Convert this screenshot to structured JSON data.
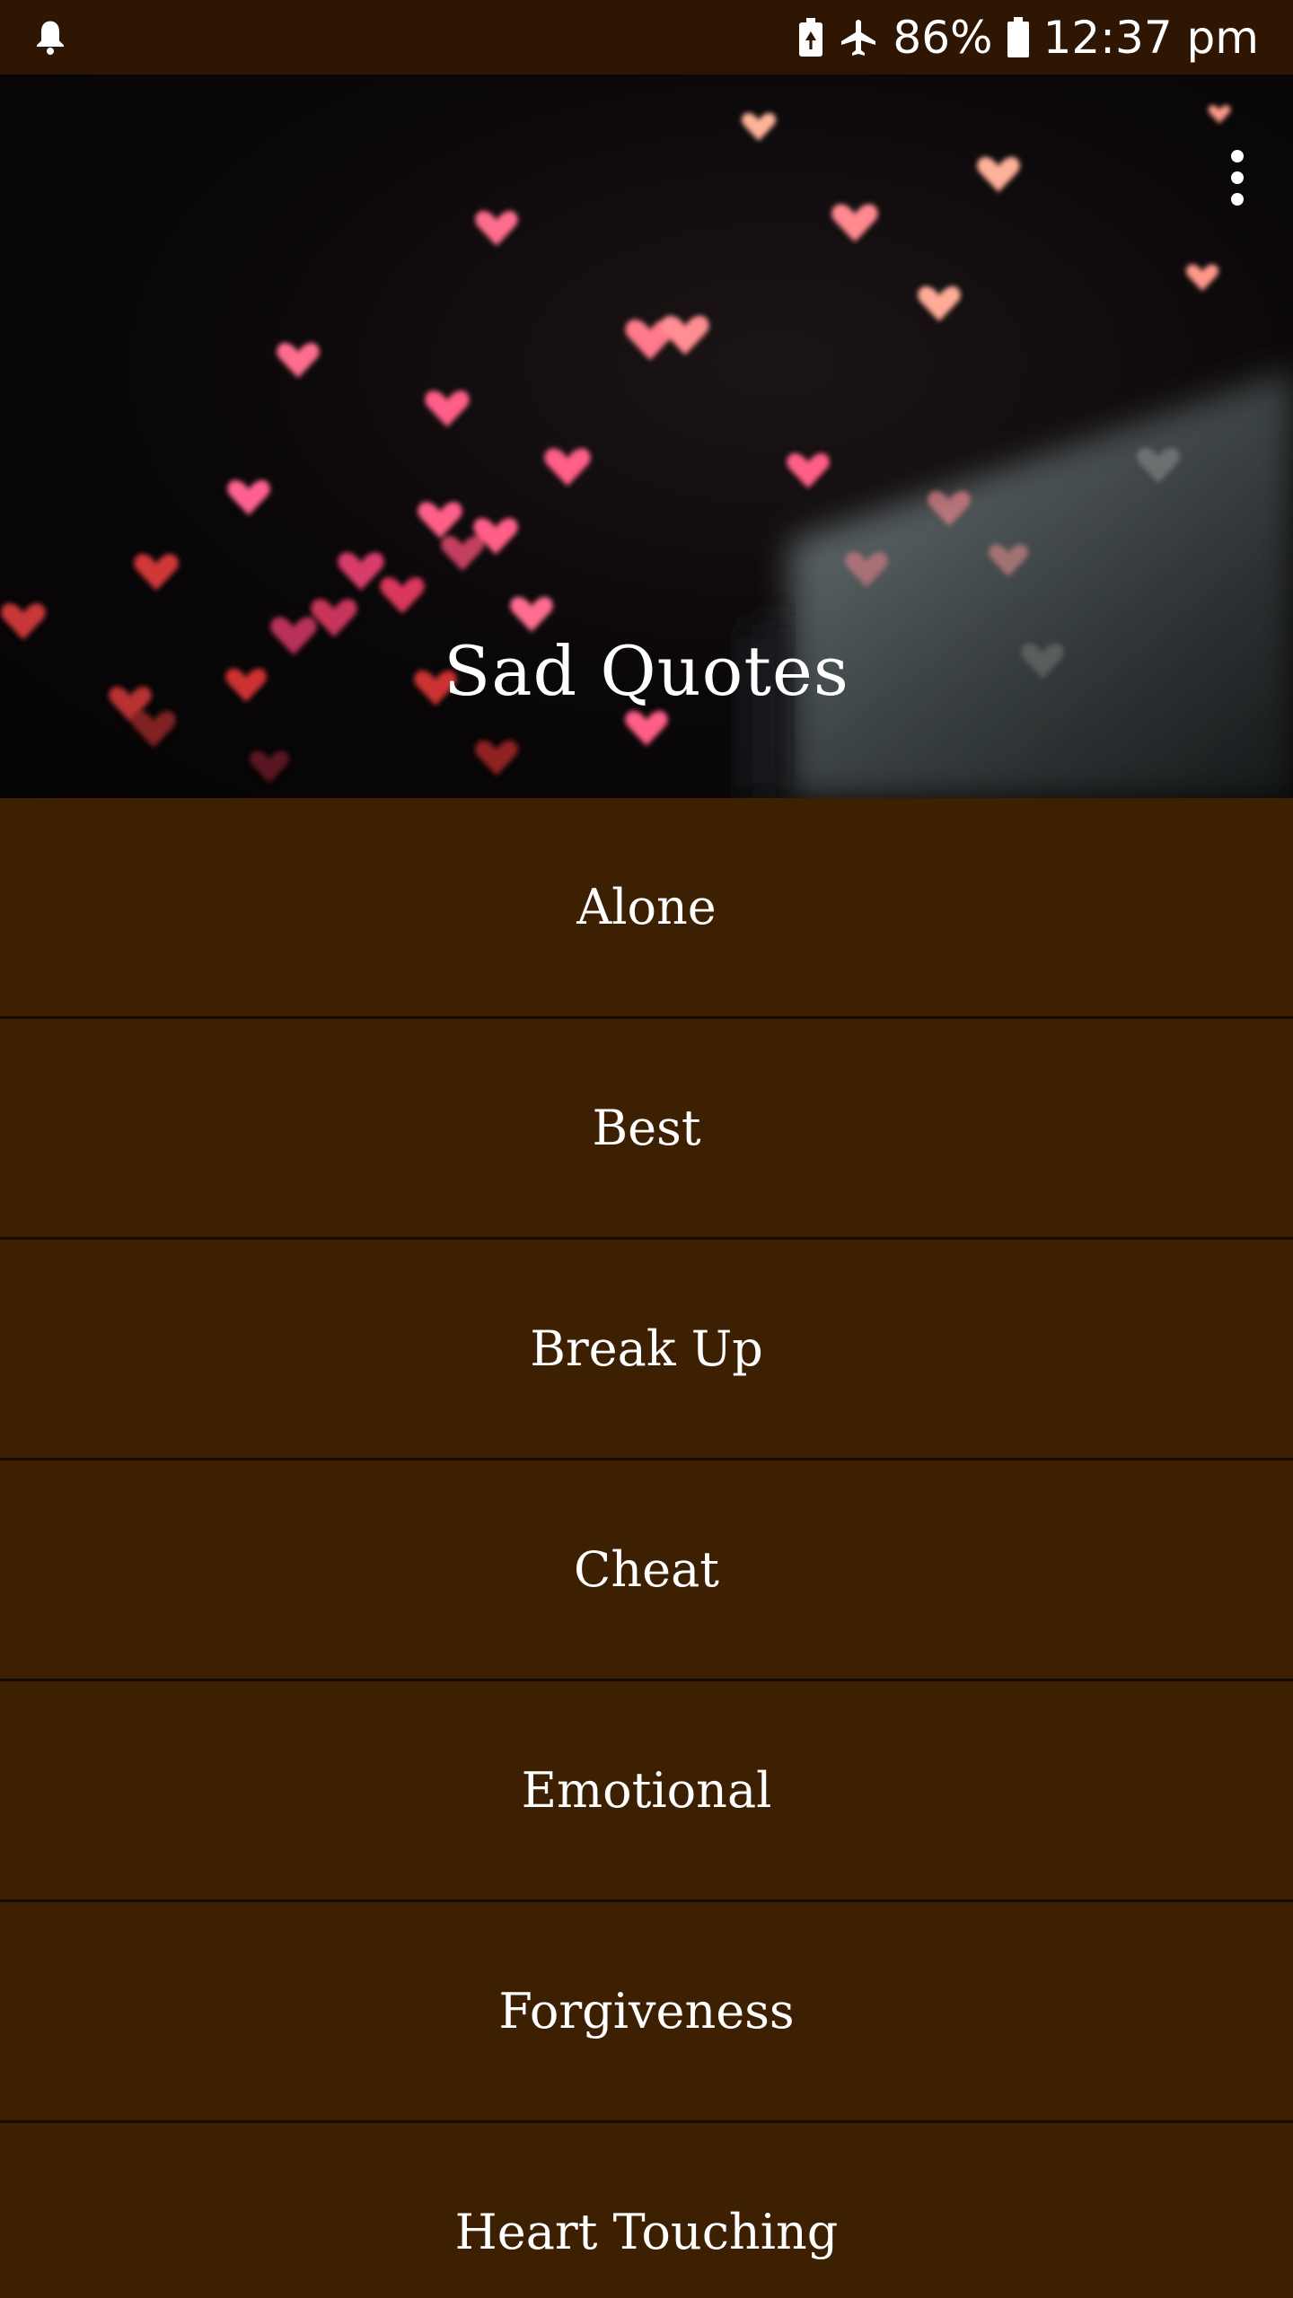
{
  "status_bar": {
    "battery_percent": "86%",
    "time": "12:37 pm",
    "icons": [
      "notification-bell-icon",
      "battery-saver-icon",
      "airplane-mode-icon",
      "battery-icon"
    ]
  },
  "header": {
    "title": "Sad Quotes",
    "menu_icon": "more-vert-icon"
  },
  "categories": [
    {
      "label": "Alone"
    },
    {
      "label": "Best"
    },
    {
      "label": "Break Up"
    },
    {
      "label": "Cheat"
    },
    {
      "label": "Emotional"
    },
    {
      "label": "Forgiveness"
    },
    {
      "label": "Heart Touching"
    }
  ],
  "colors": {
    "status_bar_bg": "#2e1602",
    "list_bg": "#3d1f02",
    "divider": "#150a01",
    "text": "#ffffff"
  }
}
